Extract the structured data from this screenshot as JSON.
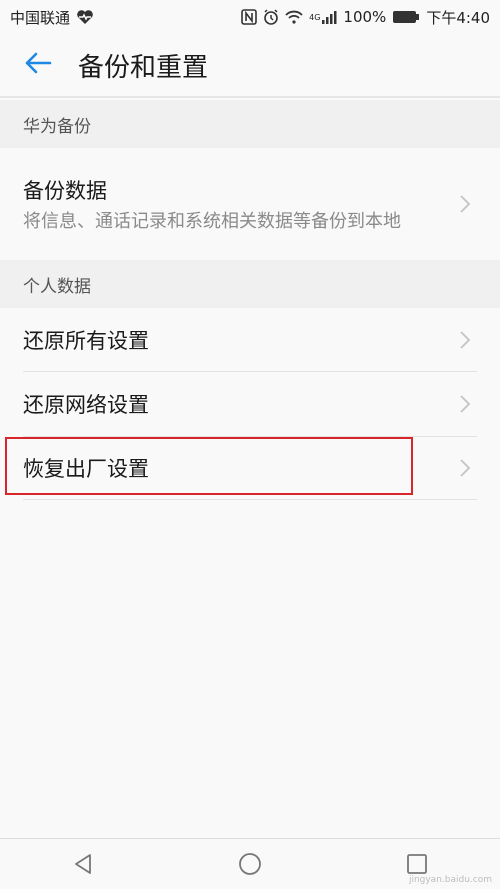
{
  "status_bar": {
    "carrier": "中国联通",
    "battery": "100%",
    "network": "4G",
    "time": "下午4:40"
  },
  "app_bar": {
    "title": "备份和重置"
  },
  "sections": [
    {
      "header": "华为备份",
      "items": [
        {
          "label": "备份数据",
          "description": "将信息、通话记录和系统相关数据等备份到本地"
        }
      ]
    },
    {
      "header": "个人数据",
      "items": [
        {
          "label": "还原所有设置"
        },
        {
          "label": "还原网络设置"
        },
        {
          "label": "恢复出厂设置"
        }
      ]
    }
  ],
  "colors": {
    "accent": "#1e88e5",
    "highlight_box": "#d9262c"
  },
  "icons": {
    "back": "arrow-left-icon",
    "chevron": "chevron-right-icon",
    "nav": [
      "back-triangle-icon",
      "home-circle-icon",
      "recents-square-icon"
    ]
  },
  "watermark": "jingyan.baidu.com"
}
